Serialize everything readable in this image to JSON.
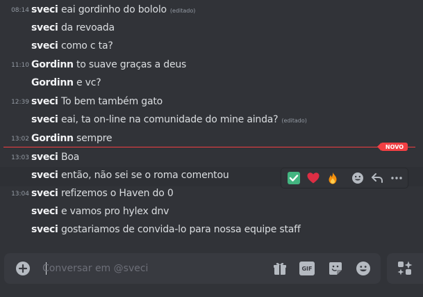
{
  "messages": [
    {
      "time": "08:14",
      "author": "sveci",
      "text": "eai gordinho do bololo",
      "edited": "(editado)"
    },
    {
      "time": "",
      "author": "sveci",
      "text": "da revoada",
      "edited": ""
    },
    {
      "time": "",
      "author": "sveci",
      "text": "como c ta?",
      "edited": ""
    },
    {
      "time": "11:10",
      "author": "Gordinn",
      "text": "to suave graças a deus",
      "edited": ""
    },
    {
      "time": "",
      "author": "Gordinn",
      "text": "e vc?",
      "edited": ""
    },
    {
      "time": "12:39",
      "author": "sveci",
      "text": "To bem também gato",
      "edited": ""
    },
    {
      "time": "",
      "author": "sveci",
      "text": "eai, ta on-line na comunidade do mine ainda?",
      "edited": "(editado)"
    },
    {
      "time": "13:02",
      "author": "Gordinn",
      "text": "sempre",
      "edited": ""
    },
    {
      "time": "13:03",
      "author": "sveci",
      "text": "Boa",
      "edited": ""
    },
    {
      "time": "",
      "author": "sveci",
      "text": "então, não sei se o roma comentou",
      "edited": ""
    },
    {
      "time": "13:04",
      "author": "sveci",
      "text": "refizemos o Haven do 0",
      "edited": ""
    },
    {
      "time": "",
      "author": "sveci",
      "text": "e vamos pro hylex dnv",
      "edited": ""
    },
    {
      "time": "",
      "author": "sveci",
      "text": "gostariamos de convida-lo para nossa equipe staff",
      "edited": ""
    }
  ],
  "new_divider": {
    "label": "NOVO"
  },
  "hover_toolbar": {
    "reactions": [
      "✅",
      "❤️",
      "🔥"
    ],
    "icons": [
      "add-reaction-icon",
      "reply-icon",
      "more-icon"
    ]
  },
  "composer": {
    "placeholder": "Conversar em @sveci",
    "icons": [
      "add-attachment-icon",
      "gift-icon",
      "gif-icon",
      "sticker-icon",
      "emoji-icon",
      "apps-icon"
    ],
    "gif_label": "GIF"
  },
  "colors": {
    "background": "#313338",
    "divider": "#f23f43",
    "composer": "#383a40"
  }
}
